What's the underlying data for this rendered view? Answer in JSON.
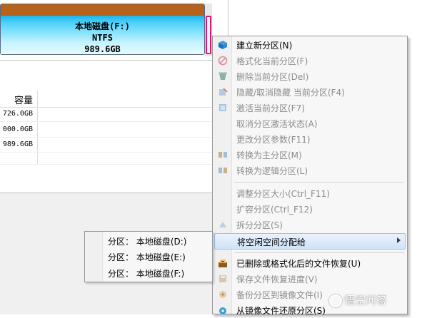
{
  "disk": {
    "partition_name": "本地磁盘(F:)",
    "filesystem": "NTFS",
    "size": "989.6GB",
    "strip_color": "#b4621c",
    "body_color": "#4fd0f8"
  },
  "table": {
    "capacity_header": "容量",
    "rows": [
      {
        "capacity": "726.0GB"
      },
      {
        "capacity": "000.0GB"
      },
      {
        "capacity": "989.6GB"
      }
    ]
  },
  "context_menu": {
    "items": [
      {
        "label": "建立新分区(N)",
        "icon": "new-partition-icon",
        "enabled": true
      },
      {
        "label": "格式化当前分区(F)",
        "icon": "format-icon",
        "enabled": false
      },
      {
        "label": "删除当前分区(Del)",
        "icon": "delete-icon",
        "enabled": false
      },
      {
        "label": "隐藏/取消隐藏 当前分区(F4)",
        "icon": "hide-icon",
        "enabled": false
      },
      {
        "label": "激活当前分区(F7)",
        "icon": "activate-icon",
        "enabled": false
      },
      {
        "label": "取消分区激活状态(A)",
        "icon": "",
        "enabled": false
      },
      {
        "label": "更改分区参数(F11)",
        "icon": "",
        "enabled": false
      },
      {
        "label": "转换为主分区(M)",
        "icon": "convert-primary-icon",
        "enabled": false
      },
      {
        "label": "转换为逻辑分区(L)",
        "icon": "convert-logical-icon",
        "enabled": false
      },
      {
        "label": "调整分区大小(Ctrl_F11)",
        "icon": "",
        "enabled": false
      },
      {
        "label": "扩容分区(Ctrl_F12)",
        "icon": "",
        "enabled": false
      },
      {
        "label": "拆分分区(S)",
        "icon": "split-icon",
        "enabled": false
      },
      {
        "label": "将空闲空间分配给",
        "icon": "",
        "enabled": true
      },
      {
        "label": "已删除或格式化后的文件恢复(U)",
        "icon": "file-recovery-icon",
        "enabled": true
      },
      {
        "label": "保存文件恢复进度(V)",
        "icon": "save-progress-icon",
        "enabled": false
      },
      {
        "label": "备份分区到镜像文件(I)",
        "icon": "backup-icon",
        "enabled": false
      },
      {
        "label": "从镜像文件还原分区(S)",
        "icon": "restore-icon",
        "enabled": true
      }
    ]
  },
  "submenu": {
    "items": [
      {
        "label": "分区：  本地磁盘(D:)"
      },
      {
        "label": "分区：  本地磁盘(E:)"
      },
      {
        "label": "分区：  本地磁盘(F:)"
      }
    ]
  },
  "watermark": {
    "text": "悟空问答"
  }
}
